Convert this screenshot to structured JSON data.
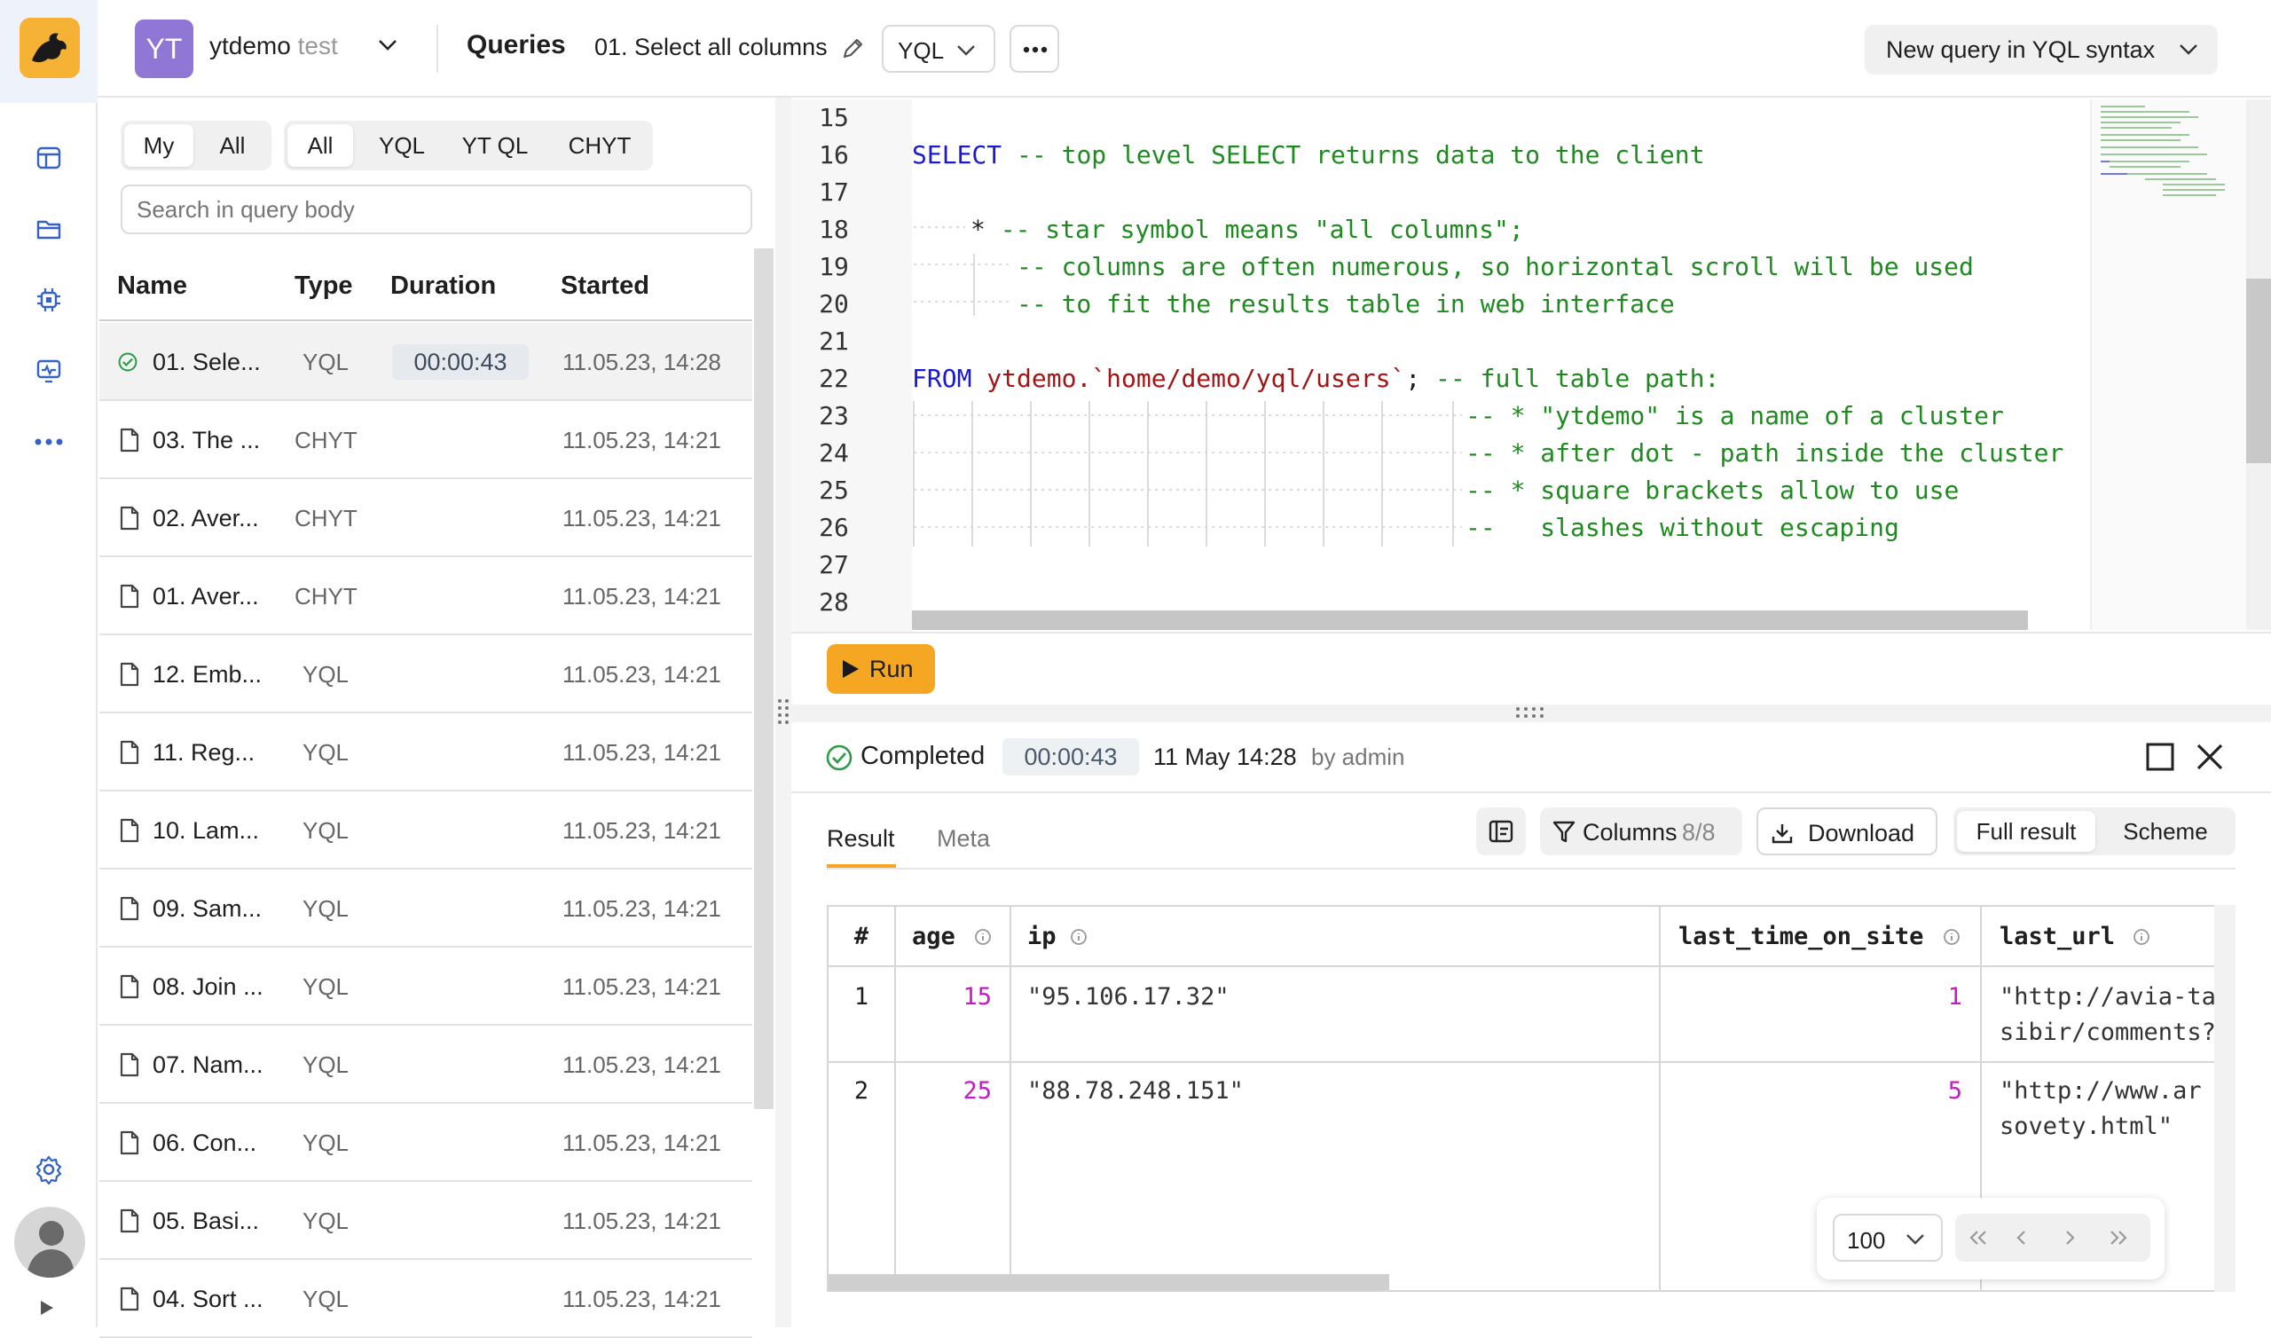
{
  "header": {
    "cluster_badge": "YT",
    "cluster_name": "ytdemo",
    "cluster_env": "test",
    "section": "Queries",
    "query_title": "01. Select all columns",
    "engine": "YQL",
    "new_query": "New query in YQL syntax"
  },
  "filters": {
    "owner": [
      "My",
      "All"
    ],
    "engines": [
      "All",
      "YQL",
      "YT QL",
      "CHYT"
    ],
    "search_placeholder": "Search in query body"
  },
  "list": {
    "columns": [
      "Name",
      "Type",
      "Duration",
      "Started"
    ],
    "rows": [
      {
        "name": "01. Sele...",
        "type": "YQL",
        "duration": "00:00:43",
        "started": "11.05.23, 14:28"
      },
      {
        "name": "03. The ...",
        "type": "CHYT",
        "duration": "",
        "started": "11.05.23, 14:21"
      },
      {
        "name": "02. Aver...",
        "type": "CHYT",
        "duration": "",
        "started": "11.05.23, 14:21"
      },
      {
        "name": "01. Aver...",
        "type": "CHYT",
        "duration": "",
        "started": "11.05.23, 14:21"
      },
      {
        "name": "12. Emb...",
        "type": "YQL",
        "duration": "",
        "started": "11.05.23, 14:21"
      },
      {
        "name": "11. Reg...",
        "type": "YQL",
        "duration": "",
        "started": "11.05.23, 14:21"
      },
      {
        "name": "10. Lam...",
        "type": "YQL",
        "duration": "",
        "started": "11.05.23, 14:21"
      },
      {
        "name": "09. Sam...",
        "type": "YQL",
        "duration": "",
        "started": "11.05.23, 14:21"
      },
      {
        "name": "08. Join ...",
        "type": "YQL",
        "duration": "",
        "started": "11.05.23, 14:21"
      },
      {
        "name": "07. Nam...",
        "type": "YQL",
        "duration": "",
        "started": "11.05.23, 14:21"
      },
      {
        "name": "06. Con...",
        "type": "YQL",
        "duration": "",
        "started": "11.05.23, 14:21"
      },
      {
        "name": "05. Basi...",
        "type": "YQL",
        "duration": "",
        "started": "11.05.23, 14:21"
      },
      {
        "name": "04. Sort ...",
        "type": "YQL",
        "duration": "",
        "started": "11.05.23, 14:21"
      }
    ]
  },
  "editor": {
    "line_numbers": [
      "15",
      "16",
      "17",
      "18",
      "19",
      "20",
      "21",
      "22",
      "23",
      "24",
      "25",
      "26",
      "27",
      "28"
    ],
    "l16_kw": "SELECT",
    "l16_cm": " -- top level SELECT returns data to the client",
    "l18_star": "*",
    "l18_cm": "-- star symbol means \"all columns\";",
    "l19_cm": "-- columns are often numerous, so horizontal scroll will be used",
    "l20_cm": "-- to fit the results table in web interface",
    "l22_kw": "FROM",
    "l22_path": " ytdemo.`home/demo/yql/users`",
    "l22_semi": ";",
    "l22_cm": " -- full table path:",
    "l23_cm": "-- * \"ytdemo\" is a name of a cluster",
    "l24_cm": "-- * after dot - path inside the cluster",
    "l25_cm": "-- * square brackets allow to use",
    "l26_cm": "--   slashes without escaping",
    "run": "Run"
  },
  "result": {
    "status": "Completed",
    "duration": "00:00:43",
    "date": "11 May 14:28",
    "author": "by admin",
    "tabs": [
      "Result",
      "Meta"
    ],
    "columns_btn": "Columns",
    "columns_count": "8/8",
    "download": "Download",
    "view": [
      "Full result",
      "Scheme"
    ],
    "table": {
      "headers": [
        "#",
        "age",
        "ip",
        "last_time_on_site",
        "last_url"
      ],
      "rows": [
        {
          "n": "1",
          "age": "15",
          "ip": "\"95.106.17.32\"",
          "last": "1",
          "url1": "\"http://avia-ta",
          "url2": "sibir/comments?"
        },
        {
          "n": "2",
          "age": "25",
          "ip": "\"88.78.248.151\"",
          "last": "5",
          "url1": "\"http://www.ar",
          "url2": "sovety.html\""
        }
      ]
    },
    "page_size": "100"
  },
  "colors": {
    "accent": "#f5a623",
    "brand": "#9077d6",
    "success": "#2e9b4a",
    "number": "#c21cc2"
  }
}
